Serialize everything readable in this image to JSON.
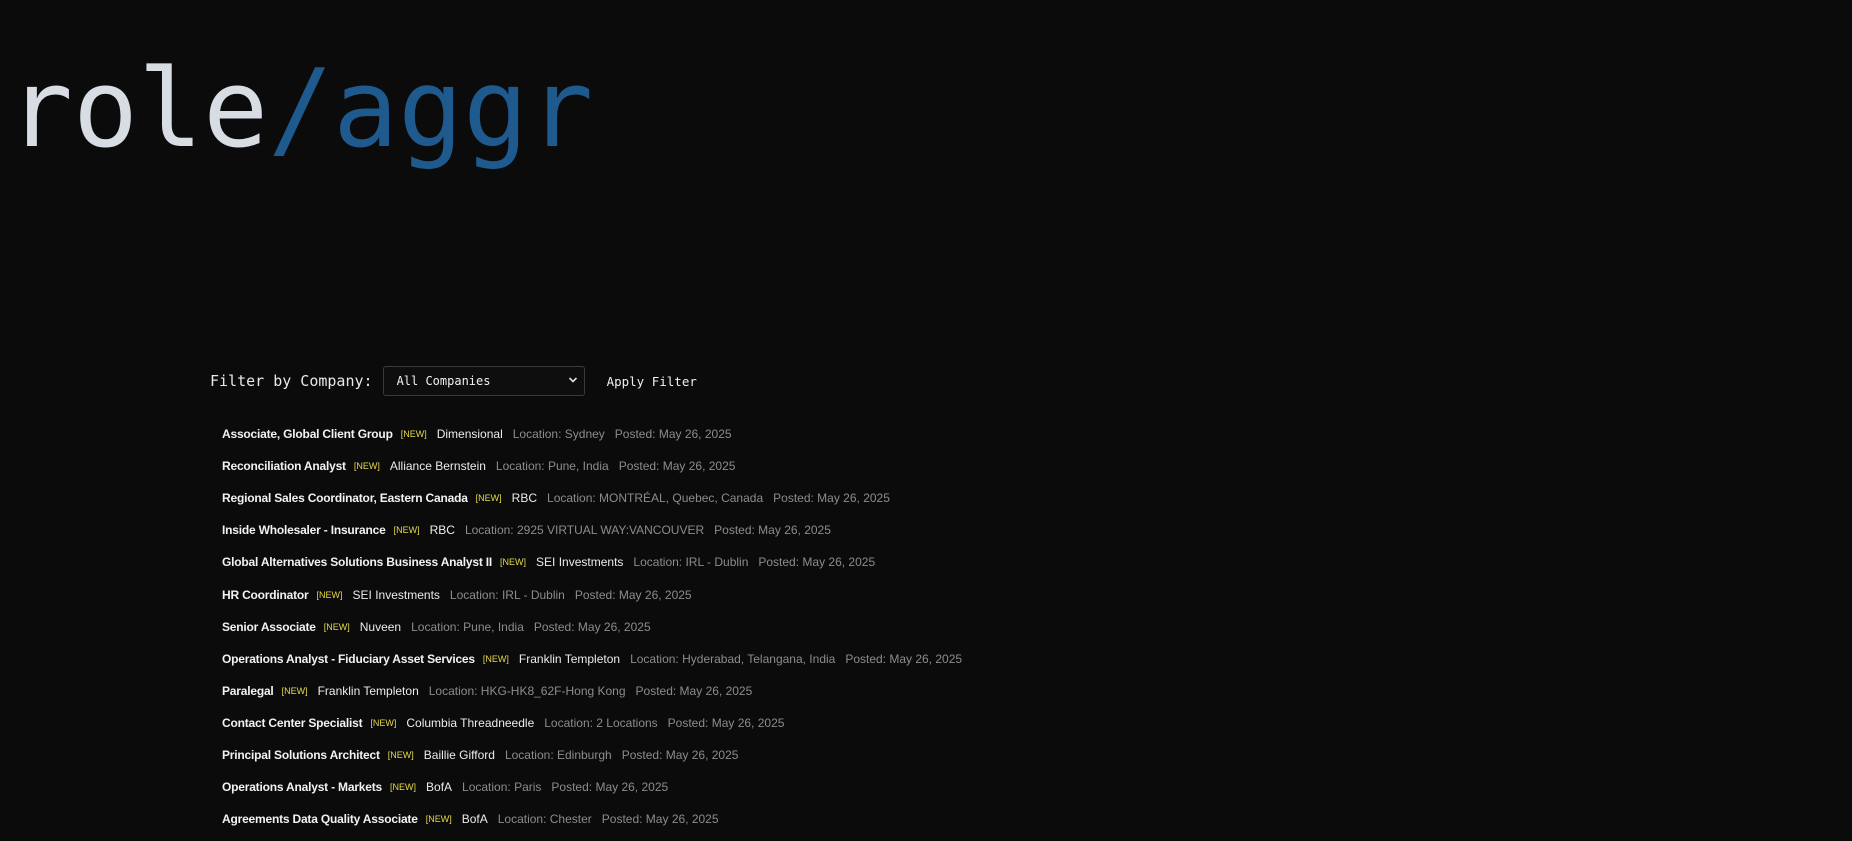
{
  "logo": {
    "part1": "role",
    "slash": "/",
    "part2": "aggr"
  },
  "filter": {
    "label": "Filter by Company:",
    "selected": "All Companies",
    "apply_label": "Apply Filter"
  },
  "jobs": [
    {
      "title": "Associate, Global Client Group",
      "badge": "[NEW]",
      "company": "Dimensional",
      "location": "Location: Sydney",
      "posted": "Posted: May 26, 2025"
    },
    {
      "title": "Reconciliation Analyst",
      "badge": "[NEW]",
      "company": "Alliance Bernstein",
      "location": "Location: Pune, India",
      "posted": "Posted: May 26, 2025"
    },
    {
      "title": "Regional Sales Coordinator, Eastern Canada",
      "badge": "[NEW]",
      "company": "RBC",
      "location": "Location: MONTRÉAL, Quebec, Canada",
      "posted": "Posted: May 26, 2025"
    },
    {
      "title": "Inside Wholesaler - Insurance",
      "badge": "[NEW]",
      "company": "RBC",
      "location": "Location: 2925 VIRTUAL WAY:VANCOUVER",
      "posted": "Posted: May 26, 2025"
    },
    {
      "title": "Global Alternatives Solutions Business Analyst II",
      "badge": "[NEW]",
      "company": "SEI Investments",
      "location": "Location: IRL - Dublin",
      "posted": "Posted: May 26, 2025"
    },
    {
      "title": "HR Coordinator",
      "badge": "[NEW]",
      "company": "SEI Investments",
      "location": "Location: IRL - Dublin",
      "posted": "Posted: May 26, 2025"
    },
    {
      "title": "Senior Associate",
      "badge": "[NEW]",
      "company": "Nuveen",
      "location": "Location: Pune, India",
      "posted": "Posted: May 26, 2025"
    },
    {
      "title": "Operations Analyst - Fiduciary Asset Services",
      "badge": "[NEW]",
      "company": "Franklin Templeton",
      "location": "Location: Hyderabad, Telangana, India",
      "posted": "Posted: May 26, 2025"
    },
    {
      "title": "Paralegal",
      "badge": "[NEW]",
      "company": "Franklin Templeton",
      "location": "Location: HKG-HK8_62F-Hong Kong",
      "posted": "Posted: May 26, 2025"
    },
    {
      "title": "Contact Center Specialist",
      "badge": "[NEW]",
      "company": "Columbia Threadneedle",
      "location": "Location: 2 Locations",
      "posted": "Posted: May 26, 2025"
    },
    {
      "title": "Principal Solutions Architect",
      "badge": "[NEW]",
      "company": "Baillie Gifford",
      "location": "Location: Edinburgh",
      "posted": "Posted: May 26, 2025"
    },
    {
      "title": "Operations Analyst - Markets",
      "badge": "[NEW]",
      "company": "BofA",
      "location": "Location: Paris",
      "posted": "Posted: May 26, 2025"
    },
    {
      "title": "Agreements Data Quality Associate",
      "badge": "[NEW]",
      "company": "BofA",
      "location": "Location: Chester",
      "posted": "Posted: May 26, 2025"
    }
  ]
}
